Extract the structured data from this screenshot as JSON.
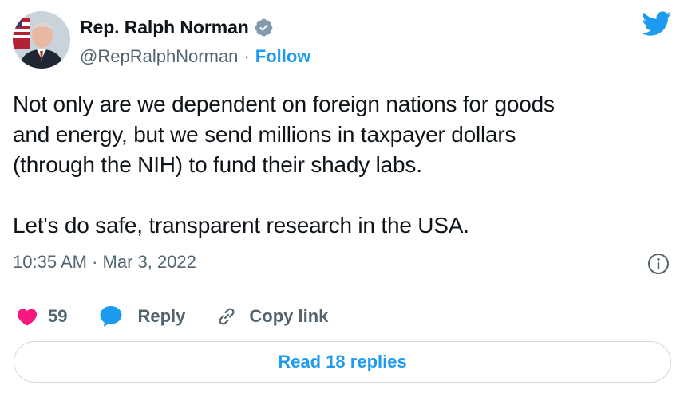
{
  "author": {
    "display_name": "Rep. Ralph Norman",
    "handle": "@RepRalphNorman",
    "separator": "·",
    "follow_label": "Follow",
    "verified": true,
    "avatar_icon": "profile-photo"
  },
  "tweet": {
    "text": "Not only are we dependent on foreign nations for goods\nand energy, but we send millions in taxpayer dollars\n(through the NIH) to fund their shady labs.\n\nLet's do safe, transparent research in the USA.",
    "timestamp": "10:35 AM · Mar 3, 2022"
  },
  "actions": {
    "like_count": "59",
    "reply_label": "Reply",
    "copy_link_label": "Copy link",
    "read_replies_label": "Read 18 replies"
  },
  "icons": {
    "brand": "twitter-bird-icon",
    "verified": "verified-badge-icon",
    "info": "info-icon",
    "like": "heart-icon",
    "reply": "speech-bubble-icon",
    "copy": "link-icon"
  },
  "colors": {
    "accent": "#1d9bf0",
    "like": "#f91880",
    "text": "#0f1419",
    "secondary": "#536471",
    "border": "#cfd9de"
  }
}
